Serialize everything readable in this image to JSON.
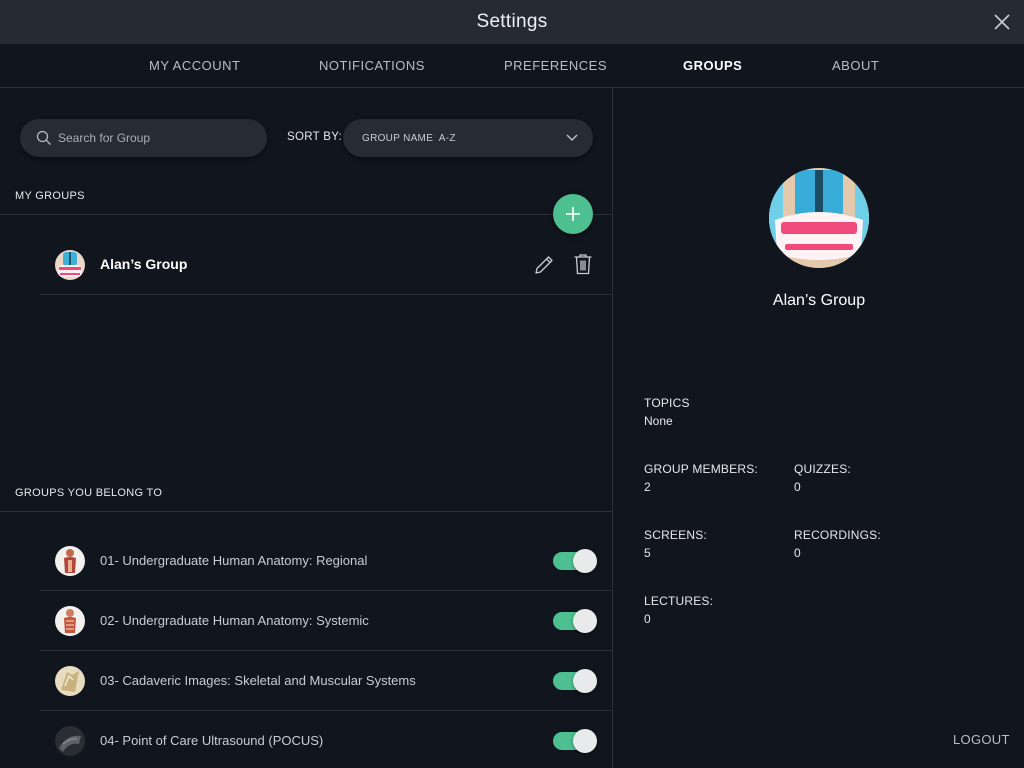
{
  "window": {
    "title": "Settings"
  },
  "tabs": [
    {
      "label": "MY ACCOUNT"
    },
    {
      "label": "NOTIFICATIONS"
    },
    {
      "label": "PREFERENCES"
    },
    {
      "label": "GROUPS",
      "active": true
    },
    {
      "label": "ABOUT"
    }
  ],
  "search": {
    "placeholder": "Search for Group",
    "value": ""
  },
  "sort": {
    "label": "SORT BY:",
    "value": "GROUP NAME  A-Z"
  },
  "my_groups": {
    "label": "MY GROUPS",
    "items": [
      {
        "name": "Alan’s Group"
      }
    ]
  },
  "belong_groups": {
    "label": "GROUPS YOU BELONG TO",
    "items": [
      {
        "name": "01- Undergraduate Human Anatomy: Regional",
        "enabled": true
      },
      {
        "name": "02- Undergraduate Human Anatomy: Systemic",
        "enabled": true
      },
      {
        "name": "03- Cadaveric Images: Skeletal and Muscular Systems",
        "enabled": true
      },
      {
        "name": "04- Point of Care Ultrasound (POCUS)",
        "enabled": true
      }
    ]
  },
  "detail": {
    "title": "Alan’s Group",
    "topics_label": "TOPICS",
    "topics_value": "None",
    "members_label": "GROUP MEMBERS:",
    "members_value": "2",
    "quizzes_label": "QUIZZES:",
    "quizzes_value": "0",
    "screens_label": "SCREENS:",
    "screens_value": "5",
    "recordings_label": "RECORDINGS:",
    "recordings_value": "0",
    "lectures_label": "LECTURES:",
    "lectures_value": "0"
  },
  "logout_label": "LOGOUT",
  "colors": {
    "accent": "#4dbf91",
    "background": "#11151d",
    "titlebar": "#252a33"
  },
  "icons": {
    "close": "close-icon",
    "search": "search-icon",
    "chevron": "chevron-down-icon",
    "add": "plus-icon",
    "edit": "pencil-icon",
    "delete": "trash-icon"
  }
}
